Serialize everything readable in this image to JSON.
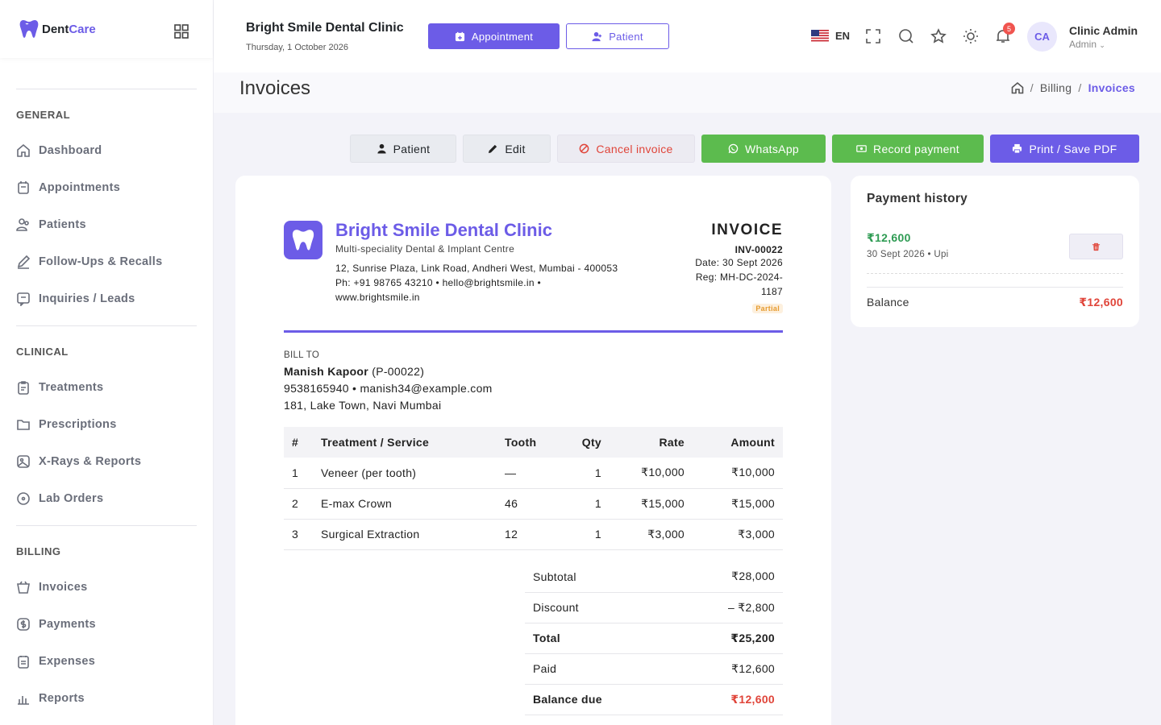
{
  "brand": {
    "name_prefix": "Dent",
    "name_suffix": "Care"
  },
  "sidebar": {
    "sections": [
      {
        "title": "GENERAL",
        "items": [
          {
            "label": "Dashboard",
            "icon": "home-icon"
          },
          {
            "label": "Appointments",
            "icon": "calendar-icon"
          },
          {
            "label": "Patients",
            "icon": "users-icon"
          },
          {
            "label": "Follow-Ups & Recalls",
            "icon": "pencil-icon"
          },
          {
            "label": "Inquiries / Leads",
            "icon": "message-icon"
          }
        ]
      },
      {
        "title": "CLINICAL",
        "items": [
          {
            "label": "Treatments",
            "icon": "clipboard-icon"
          },
          {
            "label": "Prescriptions",
            "icon": "folder-icon"
          },
          {
            "label": "X-Rays & Reports",
            "icon": "image-icon"
          },
          {
            "label": "Lab Orders",
            "icon": "circle-icon"
          }
        ]
      },
      {
        "title": "BILLING",
        "items": [
          {
            "label": "Invoices",
            "icon": "basket-icon"
          },
          {
            "label": "Payments",
            "icon": "dollar-icon"
          },
          {
            "label": "Expenses",
            "icon": "receipt-icon"
          },
          {
            "label": "Reports",
            "icon": "chart-icon"
          }
        ]
      }
    ]
  },
  "topbar": {
    "clinic_name": "Bright Smile Dental Clinic",
    "date": "Thursday, 1 October 2026",
    "appointment_btn": "Appointment",
    "patient_btn": "Patient",
    "lang": "EN",
    "notif_count": "5",
    "avatar_initials": "CA",
    "user_name": "Clinic Admin",
    "user_role": "Admin"
  },
  "page": {
    "title": "Invoices",
    "breadcrumb": [
      "Billing",
      "Invoices"
    ]
  },
  "actions": {
    "patient": "Patient",
    "edit": "Edit",
    "cancel": "Cancel invoice",
    "whatsapp": "WhatsApp",
    "record_payment": "Record payment",
    "print": "Print / Save PDF"
  },
  "invoice": {
    "clinic_name": "Bright Smile Dental Clinic",
    "tagline": "Multi-speciality Dental & Implant Centre",
    "address": "12, Sunrise Plaza, Link Road, Andheri West, Mumbai - 400053",
    "contact": "Ph: +91 98765 43210 • hello@brightsmile.in •",
    "website": "www.brightsmile.in",
    "heading": "INVOICE",
    "number": "INV-00022",
    "date": "Date: 30 Sept 2026",
    "reg_line1": "Reg: MH-DC-2024-",
    "reg_line2": "1187",
    "status": "Partial",
    "bill_to_label": "BILL TO",
    "patient_name": "Manish Kapoor",
    "patient_id": "(P-00022)",
    "patient_contact": "9538165940 • manish34@example.com",
    "patient_address": "181, Lake Town, Navi Mumbai",
    "columns": [
      "#",
      "Treatment / Service",
      "Tooth",
      "Qty",
      "Rate",
      "Amount"
    ],
    "rows": [
      [
        "1",
        "Veneer (per tooth)",
        "—",
        "1",
        "₹10,000",
        "₹10,000"
      ],
      [
        "2",
        "E-max Crown",
        "46",
        "1",
        "₹15,000",
        "₹15,000"
      ],
      [
        "3",
        "Surgical Extraction",
        "12",
        "1",
        "₹3,000",
        "₹3,000"
      ]
    ],
    "totals": {
      "subtotal_label": "Subtotal",
      "subtotal": "₹28,000",
      "discount_label": "Discount",
      "discount": "– ₹2,800",
      "total_label": "Total",
      "total": "₹25,200",
      "paid_label": "Paid",
      "paid": "₹12,600",
      "balance_label": "Balance due",
      "balance": "₹12,600"
    }
  },
  "payment_history": {
    "title": "Payment history",
    "amount": "₹12,600",
    "meta": "30 Sept 2026 • Upi",
    "balance_label": "Balance",
    "balance": "₹12,600"
  },
  "colors": {
    "primary": "#6c5ce7",
    "success": "#5cbb4e",
    "danger": "#e0453a",
    "paid": "#2e9b53"
  }
}
